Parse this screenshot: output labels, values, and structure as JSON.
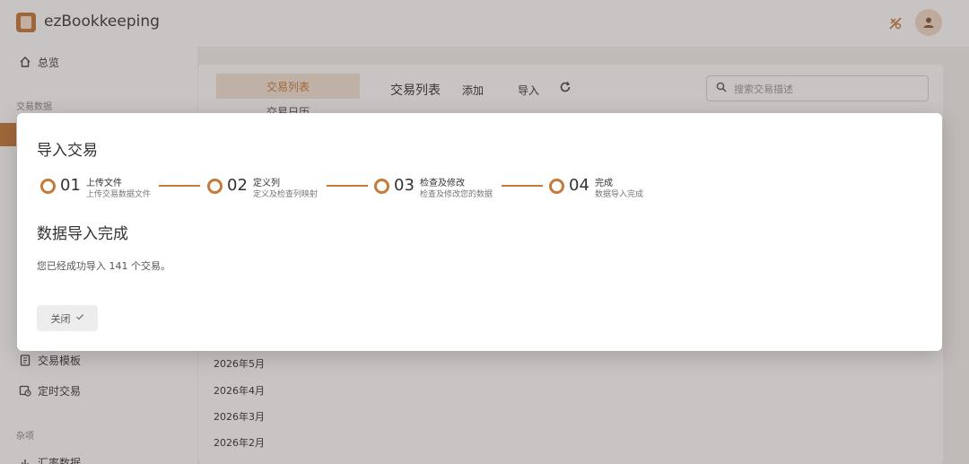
{
  "app": {
    "title": "ezBookkeeping"
  },
  "sidebar": {
    "overview": "总览",
    "section_transactions": "交易数据",
    "templates": "交易模板",
    "scheduled": "定时交易",
    "section_misc": "杂项",
    "summary": "汇率数据"
  },
  "main": {
    "tab_list": "交易列表",
    "tab_calendar": "交易日历",
    "heading": "交易列表",
    "add": "添加",
    "import": "导入",
    "search_placeholder": "搜索交易描述",
    "months": [
      "2026年5月",
      "2026年4月",
      "2026年3月",
      "2026年2月"
    ]
  },
  "dialog": {
    "title": "导入交易",
    "steps": [
      {
        "num": "01",
        "title": "上传文件",
        "sub": "上传交易数据文件"
      },
      {
        "num": "02",
        "title": "定义列",
        "sub": "定义及检查列映射"
      },
      {
        "num": "03",
        "title": "检查及修改",
        "sub": "检查及修改您的数据"
      },
      {
        "num": "04",
        "title": "完成",
        "sub": "数据导入完成"
      }
    ],
    "done_title": "数据导入完成",
    "done_message": "您已经成功导入 141 个交易。",
    "close_label": "关闭"
  },
  "colors": {
    "accent": "#c67a3a"
  },
  "icons": [
    "logo-icon",
    "theme-toggle-icon",
    "user-icon",
    "home-icon",
    "template-icon",
    "calendar-clock-icon",
    "search-icon",
    "refresh-icon",
    "check-icon"
  ]
}
